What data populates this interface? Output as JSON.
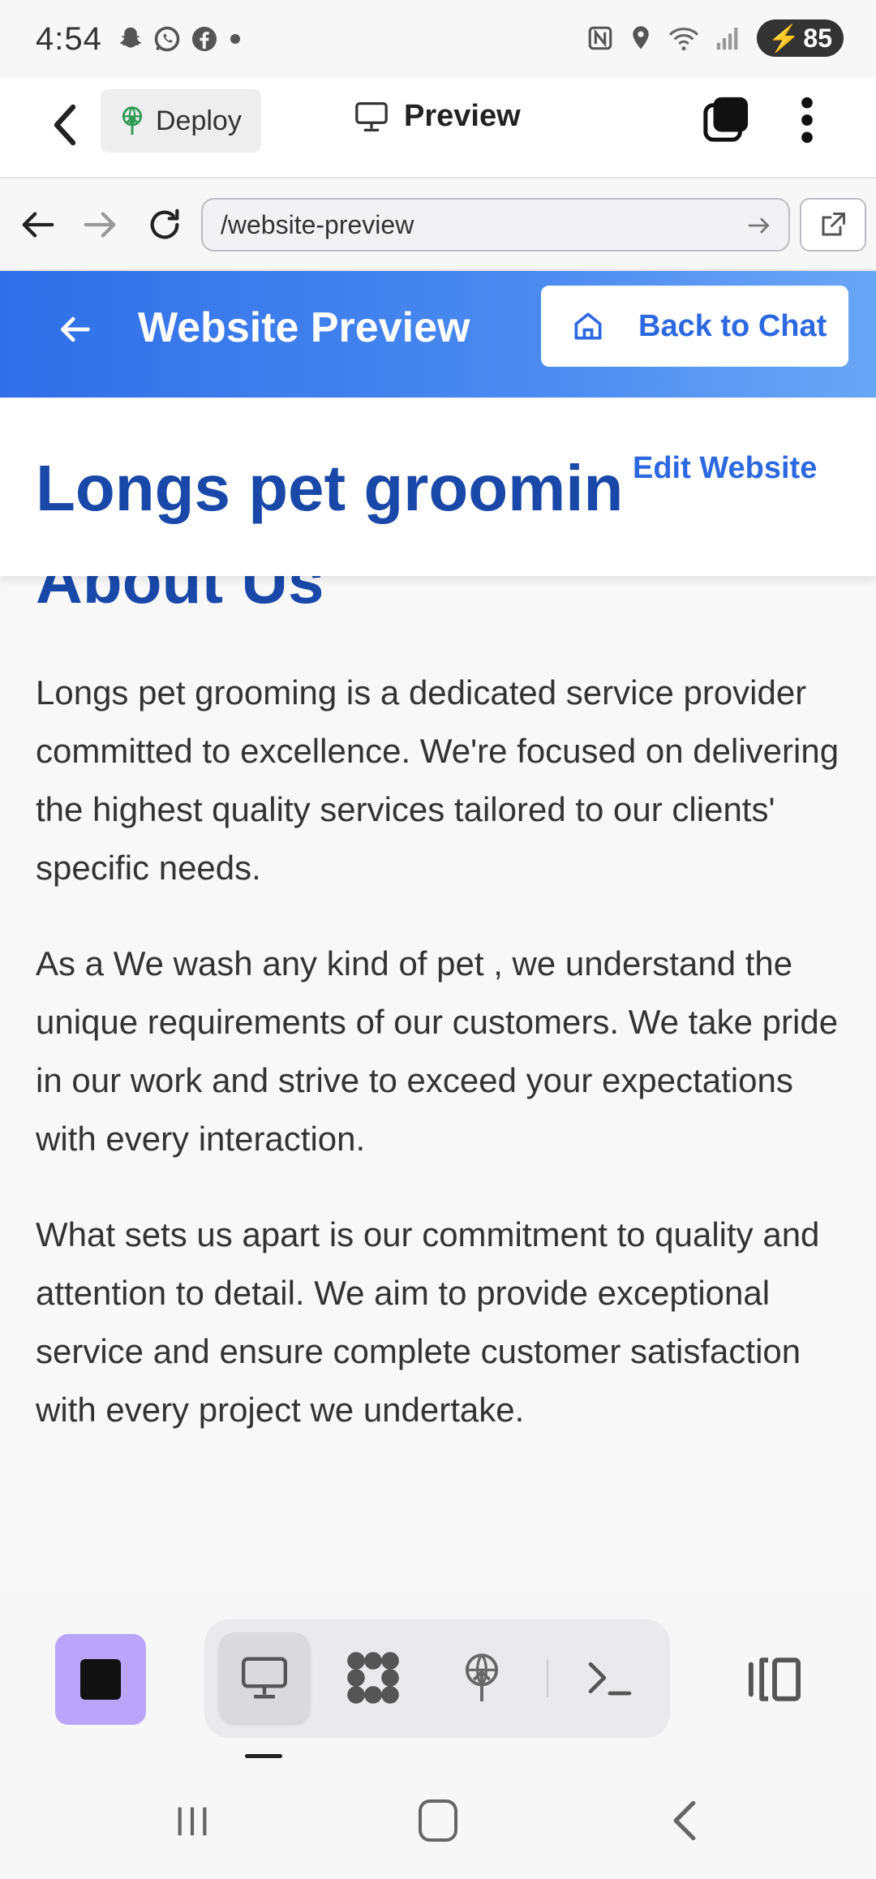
{
  "status_bar": {
    "time": "4:54",
    "battery": "85",
    "left_icons": [
      "snapchat-icon",
      "whatsapp-icon",
      "facebook-icon",
      "dot-icon"
    ],
    "right_icons": [
      "nfc-icon",
      "location-icon",
      "wifi-icon",
      "signal-icon",
      "battery-icon"
    ]
  },
  "app_toolbar": {
    "deploy_label": "Deploy",
    "preview_label": "Preview"
  },
  "browser": {
    "url": "/website-preview"
  },
  "preview_header": {
    "title": "Website Preview",
    "back_to_chat_label": "Back to Chat",
    "accent_color": "#2f6fe8"
  },
  "site": {
    "title": "Longs pet grooming",
    "edit_label": "Edit Website",
    "section_heading": "About Us",
    "paragraphs": [
      "Longs pet grooming is a dedicated service provider committed to excellence. We're focused on delivering the highest quality services tailored to our clients' specific needs.",
      "As a We wash any kind of pet , we understand the unique requirements of our customers. We take pride in our work and strive to exceed your expectations with every interaction.",
      "What sets us apart is our commitment to quality and attention to detail. We aim to provide exceptional service and ensure complete customer satisfaction with every project we undertake."
    ]
  },
  "bottom_toolbar": {
    "stop_color": "#b9a6fb",
    "items": [
      "desktop-preview-icon",
      "apps-grid-icon",
      "deploy-icon",
      "terminal-icon"
    ],
    "selected_item": "desktop-preview-icon"
  }
}
